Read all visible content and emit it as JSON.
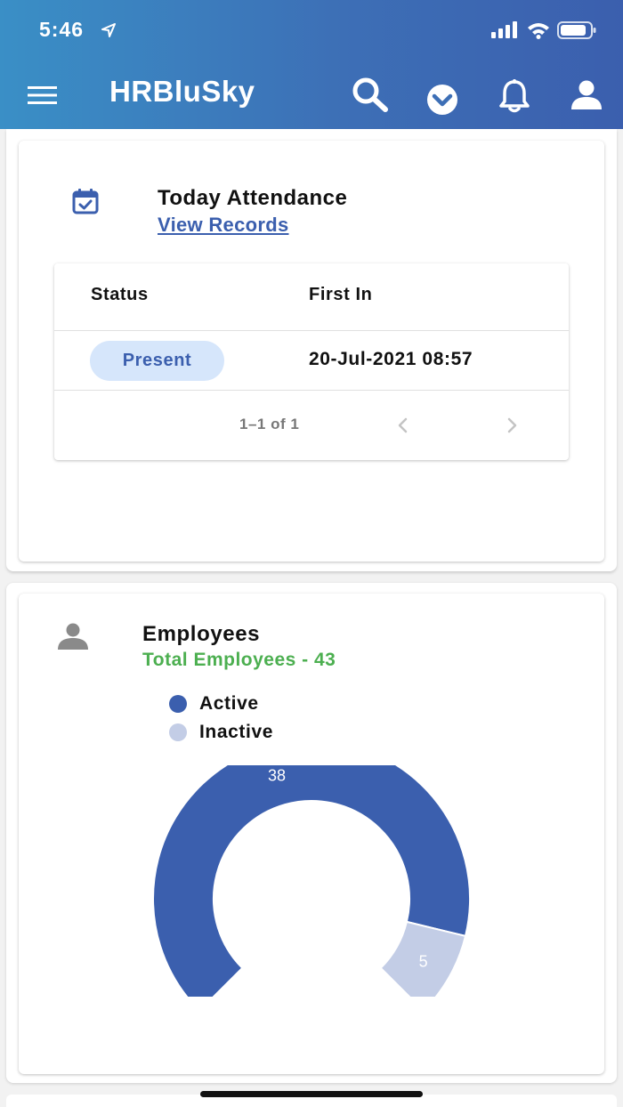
{
  "status_bar": {
    "time": "5:46"
  },
  "app_bar": {
    "title": "HRBluSky"
  },
  "attendance": {
    "title": "Today Attendance",
    "link": "View Records",
    "columns": [
      "Status",
      "First In"
    ],
    "row": {
      "status": "Present",
      "first_in": "20-Jul-2021 08:57"
    },
    "pagination": "1–1 of 1"
  },
  "employees": {
    "title": "Employees",
    "total": "Total Employees - 43",
    "legend": [
      {
        "label": "Active",
        "color": "#3b5fae"
      },
      {
        "label": "Inactive",
        "color": "#c3cde6"
      }
    ]
  },
  "chart_data": {
    "type": "pie",
    "categories": [
      "Active",
      "Inactive"
    ],
    "values": [
      38,
      5
    ],
    "colors": [
      "#3b5fae",
      "#c3cde6"
    ],
    "total": 43,
    "legend": "top-left"
  },
  "colors": {
    "header_start": "#3a8fc6",
    "header_end": "#3b5fae",
    "accent": "#3b5fae",
    "success": "#4caf50"
  }
}
